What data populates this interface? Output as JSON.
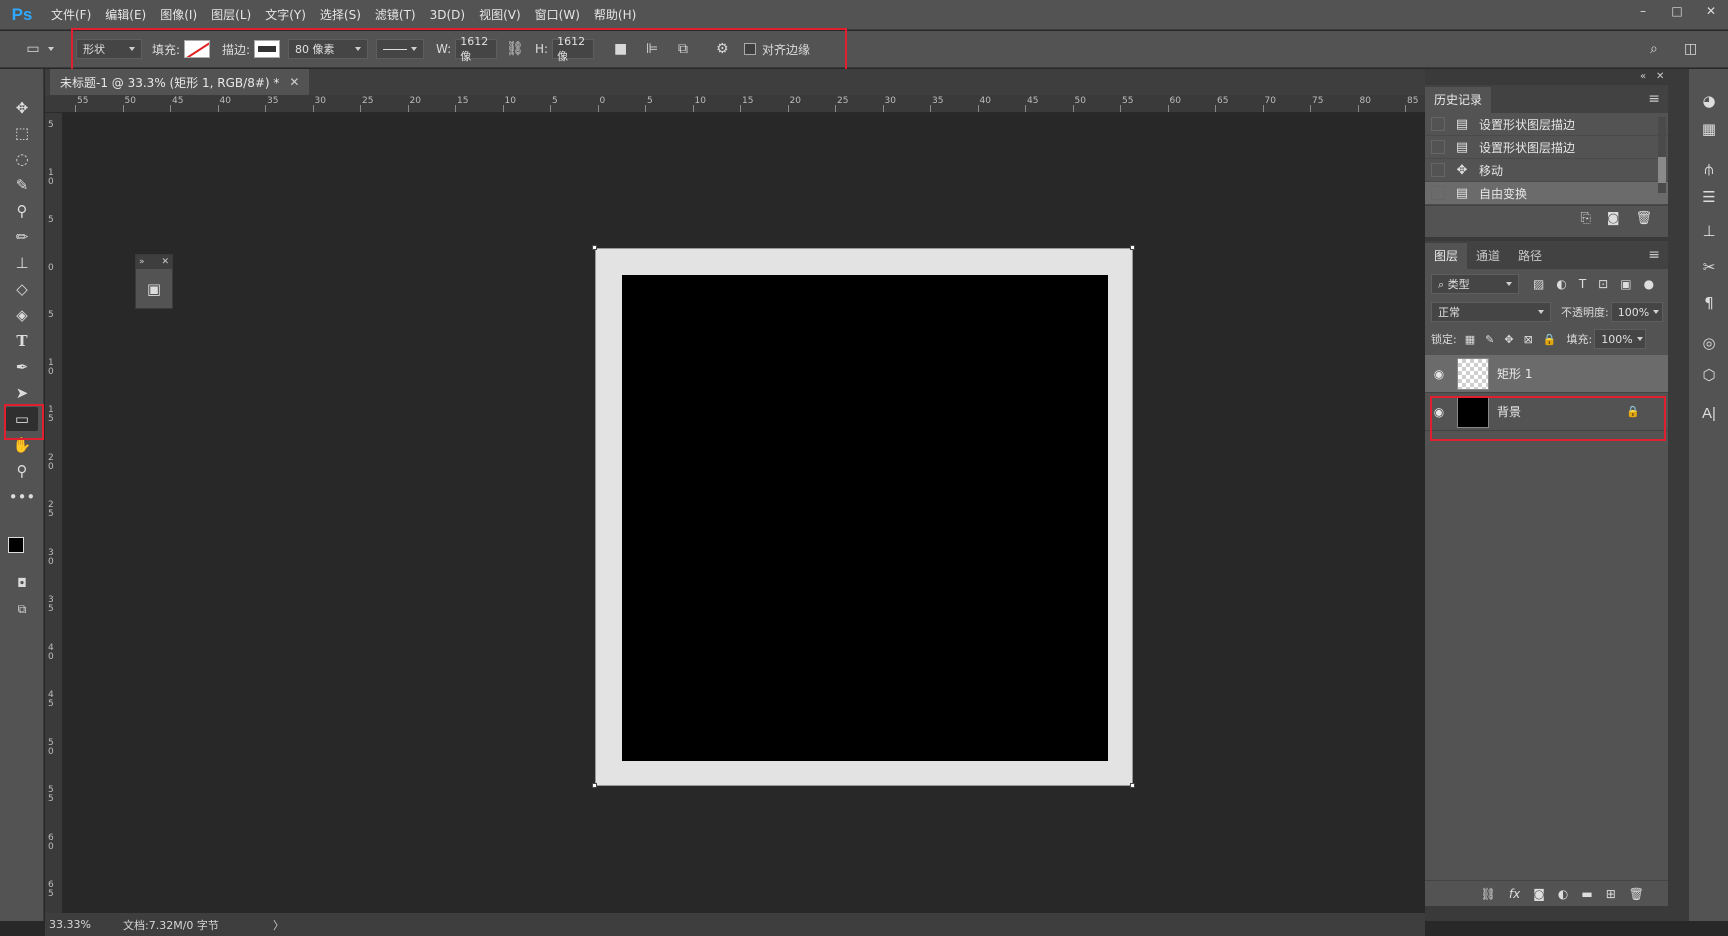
{
  "app": {
    "logo": "Ps"
  },
  "menu": [
    "文件(F)",
    "编辑(E)",
    "图像(I)",
    "图层(L)",
    "文字(Y)",
    "选择(S)",
    "滤镜(T)",
    "3D(D)",
    "视图(V)",
    "窗口(W)",
    "帮助(H)"
  ],
  "window_controls": [
    "–",
    "□",
    "✕"
  ],
  "options": {
    "mode": "形状",
    "fill_label": "填充:",
    "stroke_label": "描边:",
    "stroke_width": "80 像素",
    "w_label": "W:",
    "w_value": "1612 像",
    "h_label": "H:",
    "h_value": "1612 像",
    "align_edges": "对齐边缘",
    "accent": "#e0202e"
  },
  "document": {
    "tab_title": "未标题-1 @ 33.3% (矩形 1, RGB/8#) *",
    "close": "✕"
  },
  "ruler_h": [
    "55",
    "50",
    "45",
    "40",
    "35",
    "30",
    "25",
    "20",
    "15",
    "10",
    "5",
    "0",
    "5",
    "10",
    "15",
    "20",
    "25",
    "30",
    "35",
    "40",
    "45",
    "50",
    "55",
    "60",
    "65",
    "70",
    "75",
    "80",
    "85"
  ],
  "ruler_v": [
    "5",
    "10",
    "5",
    "0",
    "5",
    "10",
    "15",
    "20",
    "25",
    "30",
    "35",
    "40",
    "45",
    "50",
    "55",
    "60",
    "65"
  ],
  "status": {
    "zoom": "33.33%",
    "doc": "文档:7.32M/0 字节",
    "arrow": "〉"
  },
  "history": {
    "tab": "历史记录",
    "items": [
      {
        "label": "设置形状图层描边",
        "icon": "document-icon",
        "selected": false
      },
      {
        "label": "设置形状图层描边",
        "icon": "document-icon",
        "selected": false
      },
      {
        "label": "移动",
        "icon": "move-icon",
        "selected": false
      },
      {
        "label": "自由变换",
        "icon": "document-icon",
        "selected": true
      }
    ]
  },
  "layers_panel": {
    "tabs": [
      "图层",
      "通道",
      "路径"
    ],
    "filter": "类型",
    "blend_mode": "正常",
    "opacity_label": "不透明度:",
    "opacity": "100%",
    "lock_label": "锁定:",
    "fill_label": "填充:",
    "fill": "100%",
    "layers": [
      {
        "name": "矩形 1",
        "thumb": "transparent",
        "selected": true
      },
      {
        "name": "背景",
        "thumb": "black",
        "locked": true
      }
    ]
  }
}
